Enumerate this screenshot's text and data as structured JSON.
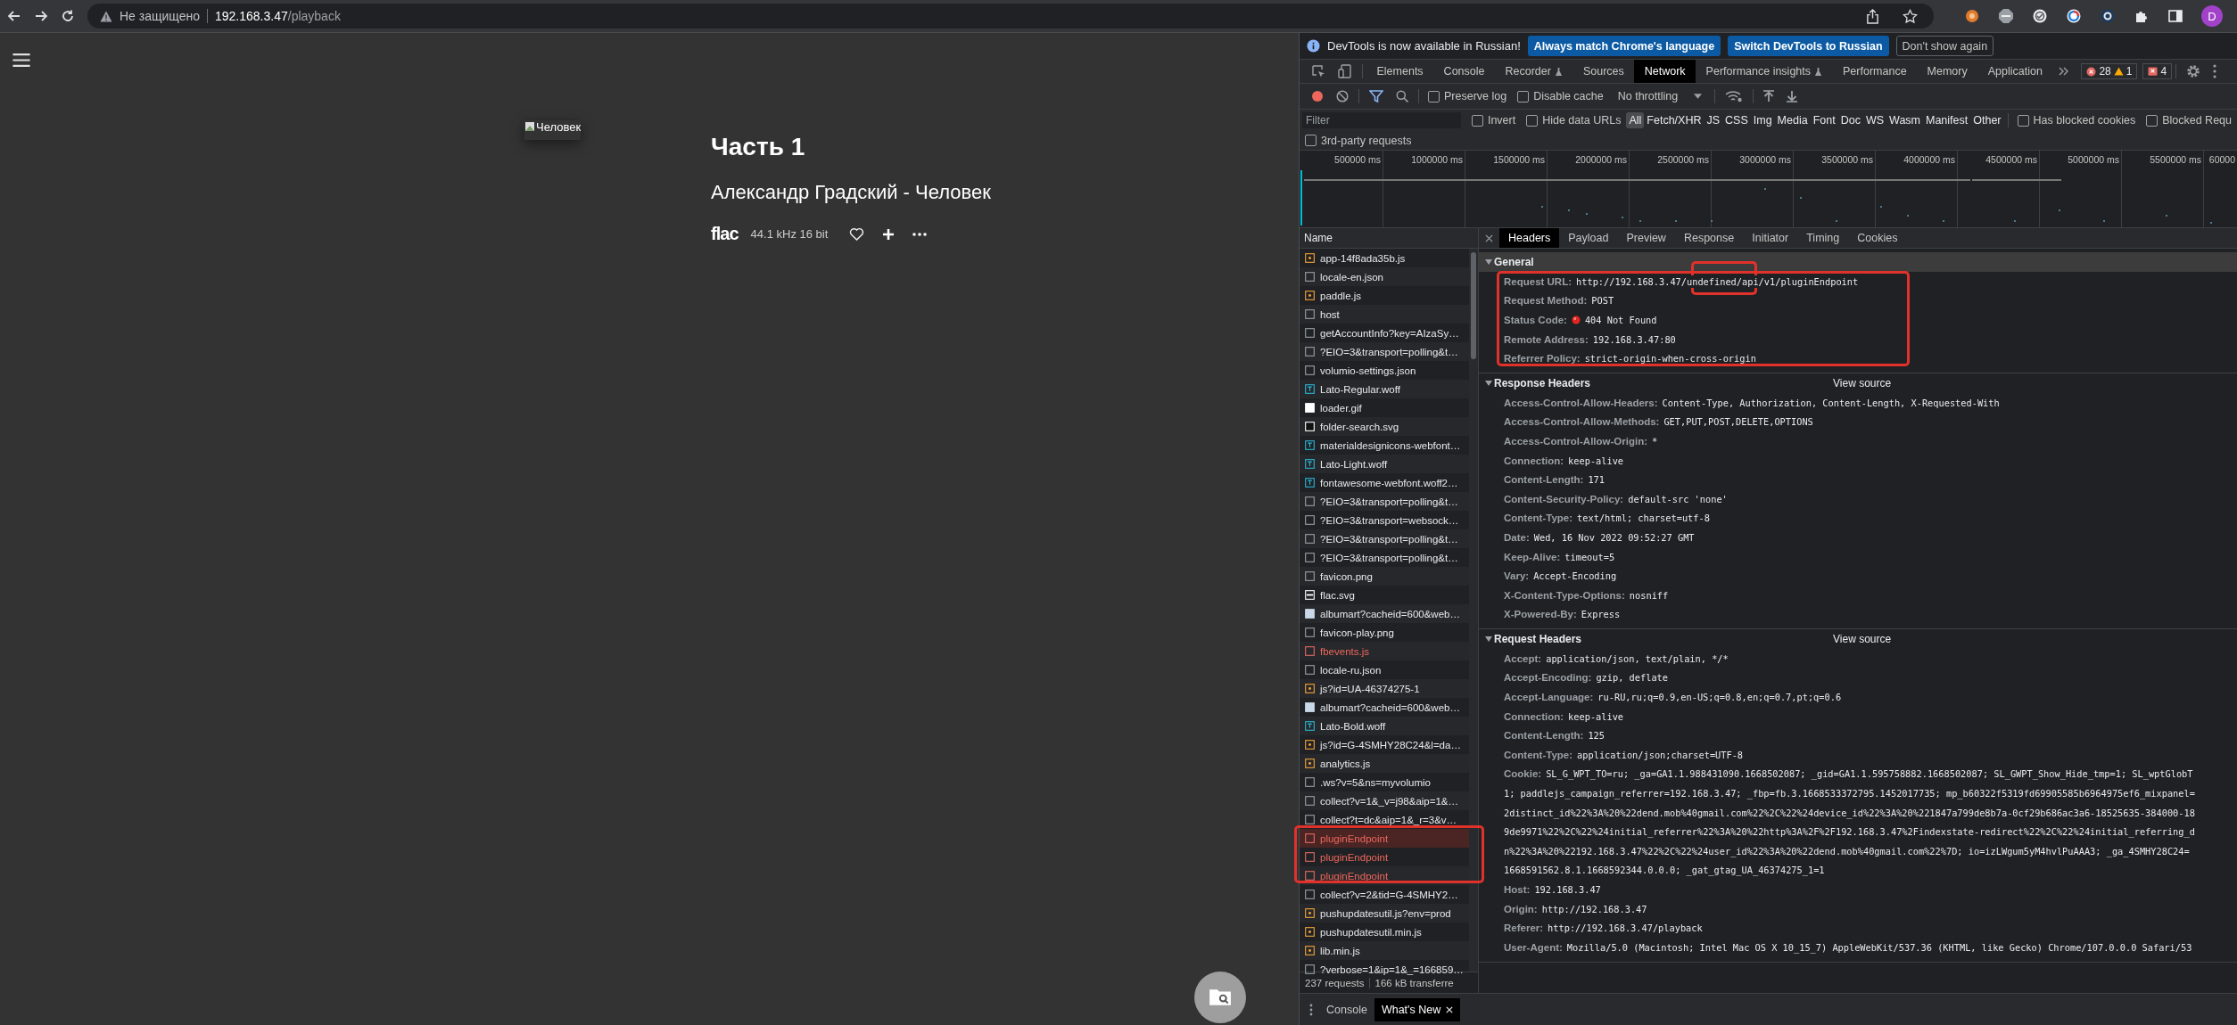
{
  "browser": {
    "security_label": "Не защищено",
    "url_host": "192.168.3.47",
    "url_path": "/playback",
    "profile_initial": "D"
  },
  "page": {
    "cover_alt": "Человек",
    "title": "Часть 1",
    "subtitle": "Александр Градский - Человек",
    "format": "flac",
    "quality": "44.1 kHz 16 bit"
  },
  "devtools": {
    "infobar": {
      "message": "DevTools is now available in Russian!",
      "buttons": [
        {
          "label": "Always match Chrome's language",
          "kind": "primary"
        },
        {
          "label": "Switch DevTools to Russian",
          "kind": "primary"
        },
        {
          "label": "Don't show again",
          "kind": "outline"
        }
      ]
    },
    "panels": [
      {
        "label": "Elements",
        "selected": false,
        "experimental": false
      },
      {
        "label": "Console",
        "selected": false,
        "experimental": false
      },
      {
        "label": "Recorder",
        "selected": false,
        "experimental": true
      },
      {
        "label": "Sources",
        "selected": false,
        "experimental": false
      },
      {
        "label": "Network",
        "selected": true,
        "experimental": false
      },
      {
        "label": "Performance insights",
        "selected": false,
        "experimental": true
      },
      {
        "label": "Performance",
        "selected": false,
        "experimental": false
      },
      {
        "label": "Memory",
        "selected": false,
        "experimental": false
      },
      {
        "label": "Application",
        "selected": false,
        "experimental": false
      }
    ],
    "counts": {
      "errors": "28",
      "warnings": "1",
      "issues": "4"
    },
    "toolbar": {
      "recording": true,
      "filter_on": true,
      "options": [
        {
          "label": "Preserve log",
          "checked": false
        },
        {
          "label": "Disable cache",
          "checked": false
        }
      ],
      "throttling": "No throttling"
    },
    "filter": {
      "placeholder": "Filter",
      "options": [
        {
          "label": "Invert",
          "checked": false
        },
        {
          "label": "Hide data URLs",
          "checked": false
        }
      ],
      "types": [
        {
          "label": "All",
          "selected": true
        },
        {
          "label": "Fetch/XHR",
          "selected": false
        },
        {
          "label": "JS",
          "selected": false
        },
        {
          "label": "CSS",
          "selected": false
        },
        {
          "label": "Img",
          "selected": false
        },
        {
          "label": "Media",
          "selected": false
        },
        {
          "label": "Font",
          "selected": false
        },
        {
          "label": "Doc",
          "selected": false
        },
        {
          "label": "WS",
          "selected": false
        },
        {
          "label": "Wasm",
          "selected": false
        },
        {
          "label": "Manifest",
          "selected": false
        },
        {
          "label": "Other",
          "selected": false
        }
      ],
      "extra_options": [
        {
          "label": "Has blocked cookies",
          "checked": false
        },
        {
          "label": "Blocked Requ",
          "checked": false
        }
      ],
      "third_party": {
        "label": "3rd-party requests",
        "checked": false
      }
    },
    "timeline_ticks": [
      "500000 ms",
      "1000000 ms",
      "1500000 ms",
      "2000000 ms",
      "2500000 ms",
      "3000000 ms",
      "3500000 ms",
      "4000000 ms",
      "4500000 ms",
      "5000000 ms",
      "5500000 ms",
      "60000"
    ],
    "requests": {
      "column": "Name",
      "rows": [
        {
          "name": "app-14f8ada35b.js",
          "kind": "script",
          "error": false,
          "selected": false
        },
        {
          "name": "locale-en.json",
          "kind": "blank",
          "error": false,
          "selected": false
        },
        {
          "name": "paddle.js",
          "kind": "script",
          "error": false,
          "selected": false
        },
        {
          "name": "host",
          "kind": "blank",
          "error": false,
          "selected": false
        },
        {
          "name": "getAccountInfo?key=AIzaSy…",
          "kind": "blank",
          "error": false,
          "selected": false
        },
        {
          "name": "?EIO=3&transport=polling&t…",
          "kind": "blank",
          "error": false,
          "selected": false
        },
        {
          "name": "volumio-settings.json",
          "kind": "blank",
          "error": false,
          "selected": false
        },
        {
          "name": "Lato-Regular.woff",
          "kind": "font",
          "error": false,
          "selected": false
        },
        {
          "name": "loader.gif",
          "kind": "image",
          "error": false,
          "selected": false
        },
        {
          "name": "folder-search.svg",
          "kind": "dark-image",
          "error": false,
          "selected": false
        },
        {
          "name": "materialdesignicons-webfont…",
          "kind": "font",
          "error": false,
          "selected": false
        },
        {
          "name": "Lato-Light.woff",
          "kind": "font",
          "error": false,
          "selected": false
        },
        {
          "name": "fontawesome-webfont.woff2…",
          "kind": "font",
          "error": false,
          "selected": false
        },
        {
          "name": "?EIO=3&transport=polling&t…",
          "kind": "blank",
          "error": false,
          "selected": false
        },
        {
          "name": "?EIO=3&transport=websock…",
          "kind": "blank",
          "error": false,
          "selected": false
        },
        {
          "name": "?EIO=3&transport=polling&t…",
          "kind": "blank",
          "error": false,
          "selected": false
        },
        {
          "name": "?EIO=3&transport=polling&t…",
          "kind": "blank",
          "error": false,
          "selected": false
        },
        {
          "name": "favicon.png",
          "kind": "blank",
          "error": false,
          "selected": false
        },
        {
          "name": "flac.svg",
          "kind": "line-image",
          "error": false,
          "selected": false
        },
        {
          "name": "albumart?cacheid=600&web…",
          "kind": "photo",
          "error": false,
          "selected": false
        },
        {
          "name": "favicon-play.png",
          "kind": "blank",
          "error": false,
          "selected": false
        },
        {
          "name": "fbevents.js",
          "kind": "blank",
          "error": true,
          "selected": false
        },
        {
          "name": "locale-ru.json",
          "kind": "blank",
          "error": false,
          "selected": false
        },
        {
          "name": "js?id=UA-46374275-1",
          "kind": "script",
          "error": false,
          "selected": false
        },
        {
          "name": "albumart?cacheid=600&web…",
          "kind": "photo",
          "error": false,
          "selected": false
        },
        {
          "name": "Lato-Bold.woff",
          "kind": "font",
          "error": false,
          "selected": false
        },
        {
          "name": "js?id=G-4SMHY28C24&l=da…",
          "kind": "script",
          "error": false,
          "selected": false
        },
        {
          "name": "analytics.js",
          "kind": "script",
          "error": false,
          "selected": false
        },
        {
          "name": ".ws?v=5&ns=myvolumio",
          "kind": "blank",
          "error": false,
          "selected": false
        },
        {
          "name": "collect?v=1&_v=j98&aip=1&…",
          "kind": "blank",
          "error": false,
          "selected": false
        },
        {
          "name": "collect?t=dc&aip=1&_r=3&v…",
          "kind": "blank",
          "error": false,
          "selected": false
        },
        {
          "name": "pluginEndpoint",
          "kind": "blank",
          "error": true,
          "selected": true
        },
        {
          "name": "pluginEndpoint",
          "kind": "blank",
          "error": true,
          "selected": false
        },
        {
          "name": "pluginEndpoint",
          "kind": "blank",
          "error": true,
          "selected": false
        },
        {
          "name": "collect?v=2&tid=G-4SMHY2…",
          "kind": "blank",
          "error": false,
          "selected": false
        },
        {
          "name": "pushupdatesutil.js?env=prod",
          "kind": "script",
          "error": false,
          "selected": false
        },
        {
          "name": "pushupdatesutil.min.js",
          "kind": "script",
          "error": false,
          "selected": false
        },
        {
          "name": "lib.min.js",
          "kind": "script",
          "error": false,
          "selected": false
        },
        {
          "name": "?verbose=1&ip=1&_=166859…",
          "kind": "blank",
          "error": false,
          "selected": false
        }
      ],
      "summary": [
        "237 requests",
        "166 kB transferre"
      ]
    },
    "detail": {
      "tabs": [
        {
          "label": "Headers",
          "selected": true
        },
        {
          "label": "Payload",
          "selected": false
        },
        {
          "label": "Preview",
          "selected": false
        },
        {
          "label": "Response",
          "selected": false
        },
        {
          "label": "Initiator",
          "selected": false
        },
        {
          "label": "Timing",
          "selected": false
        },
        {
          "label": "Cookies",
          "selected": false
        }
      ],
      "sections": [
        {
          "title": "General",
          "expanded": true,
          "rows": [
            {
              "key": "Request URL:",
              "kind": "plain",
              "value": "http://192.168.3.47/undefined/api/v1/pluginEndpoint"
            },
            {
              "key": "Request Method:",
              "kind": "plain",
              "value": "POST"
            },
            {
              "key": "Status Code:",
              "kind": "status",
              "value": "404 Not Found"
            },
            {
              "key": "Remote Address:",
              "kind": "plain",
              "value": "192.168.3.47:80"
            },
            {
              "key": "Referrer Policy:",
              "kind": "plain",
              "value": "strict-origin-when-cross-origin"
            }
          ]
        },
        {
          "title": "Response Headers",
          "expanded": true,
          "view_source": "View source",
          "rows": [
            {
              "key": "Access-Control-Allow-Headers:",
              "kind": "plain",
              "value": "Content-Type, Authorization, Content-Length, X-Requested-With"
            },
            {
              "key": "Access-Control-Allow-Methods:",
              "kind": "plain",
              "value": "GET,PUT,POST,DELETE,OPTIONS"
            },
            {
              "key": "Access-Control-Allow-Origin:",
              "kind": "plain",
              "value": "*"
            },
            {
              "key": "Connection:",
              "kind": "plain",
              "value": "keep-alive"
            },
            {
              "key": "Content-Length:",
              "kind": "plain",
              "value": "171"
            },
            {
              "key": "Content-Security-Policy:",
              "kind": "plain",
              "value": "default-src 'none'"
            },
            {
              "key": "Content-Type:",
              "kind": "plain",
              "value": "text/html; charset=utf-8"
            },
            {
              "key": "Date:",
              "kind": "plain",
              "value": "Wed, 16 Nov 2022 09:52:27 GMT"
            },
            {
              "key": "Keep-Alive:",
              "kind": "plain",
              "value": "timeout=5"
            },
            {
              "key": "Vary:",
              "kind": "plain",
              "value": "Accept-Encoding"
            },
            {
              "key": "X-Content-Type-Options:",
              "kind": "plain",
              "value": "nosniff"
            },
            {
              "key": "X-Powered-By:",
              "kind": "plain",
              "value": "Express"
            }
          ]
        },
        {
          "title": "Request Headers",
          "expanded": true,
          "view_source": "View source",
          "rows": [
            {
              "key": "Accept:",
              "kind": "plain",
              "value": "application/json, text/plain, */*"
            },
            {
              "key": "Accept-Encoding:",
              "kind": "plain",
              "value": "gzip, deflate"
            },
            {
              "key": "Accept-Language:",
              "kind": "plain",
              "value": "ru-RU,ru;q=0.9,en-US;q=0.8,en;q=0.7,pt;q=0.6"
            },
            {
              "key": "Connection:",
              "kind": "plain",
              "value": "keep-alive"
            },
            {
              "key": "Content-Length:",
              "kind": "plain",
              "value": "125"
            },
            {
              "key": "Content-Type:",
              "kind": "plain",
              "value": "application/json;charset=UTF-8"
            },
            {
              "key": "Cookie:",
              "kind": "multiline",
              "value": "SL_G_WPT_TO=ru; _ga=GA1.1.988431090.1668502087; _gid=GA1.1.595758882.1668502087; SL_GWPT_Show_Hide_tmp=1; SL_wptGlobT",
              "more_lines": [
                "1; paddlejs_campaign_referrer=192.168.3.47; _fbp=fb.3.1668533372795.1452017735; mp_b60322f5319fd69905585b6964975ef6_mixpanel=",
                "2distinct_id%22%3A%20%22dend.mob%40gmail.com%22%2C%22%24device_id%22%3A%20%221847a799de8b7a-0cf29b686ac3a6-18525635-384000-18",
                "9de9971%22%2C%22%24initial_referrer%22%3A%20%22http%3A%2F%2F192.168.3.47%2Findexstate-redirect%22%2C%22%24initial_referring_d",
                "n%22%3A%20%22192.168.3.47%22%2C%22%24user_id%22%3A%20%22dend.mob%40gmail.com%22%7D; io=izLWgum5yM4hvlPuAAA3; _ga_4SMHY28C24=",
                "1668591562.8.1.1668592344.0.0.0; _gat_gtag_UA_46374275_1=1"
              ]
            },
            {
              "key": "Host:",
              "kind": "plain",
              "value": "192.168.3.47"
            },
            {
              "key": "Origin:",
              "kind": "plain",
              "value": "http://192.168.3.47"
            },
            {
              "key": "Referer:",
              "kind": "plain",
              "value": "http://192.168.3.47/playback"
            },
            {
              "key": "User-Agent:",
              "kind": "plain",
              "value": "Mozilla/5.0 (Macintosh; Intel Mac OS X 10_15_7) AppleWebKit/537.36 (KHTML, like Gecko) Chrome/107.0.0.0 Safari/53"
            }
          ]
        }
      ]
    },
    "drawer": {
      "tabs": [
        {
          "label": "Console",
          "selected": false,
          "closable": false
        },
        {
          "label": "What's New",
          "selected": true,
          "closable": true
        }
      ]
    }
  }
}
